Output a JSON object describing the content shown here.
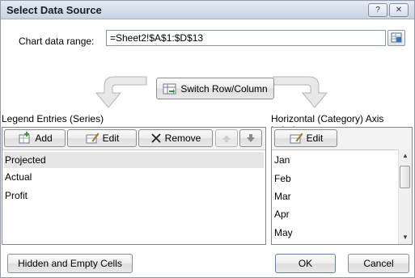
{
  "dialog": {
    "title": "Select Data Source",
    "help_label": "?",
    "close_label": "✕"
  },
  "range": {
    "label": "Chart data range:",
    "value": "=Sheet2!$A$1:$D$13"
  },
  "switch_button": {
    "label": "Switch Row/Column"
  },
  "legend": {
    "heading": "Legend Entries (Series)",
    "add_label": "Add",
    "edit_label": "Edit",
    "remove_label": "Remove",
    "items": [
      "Projected",
      "Actual",
      "Profit"
    ]
  },
  "axis": {
    "heading": "Horizontal (Category) Axis Labels",
    "edit_label": "Edit",
    "items": [
      "Jan",
      "Feb",
      "Mar",
      "Apr",
      "May"
    ]
  },
  "footer": {
    "hidden_cells_label": "Hidden and Empty Cells",
    "ok_label": "OK",
    "cancel_label": "Cancel"
  }
}
